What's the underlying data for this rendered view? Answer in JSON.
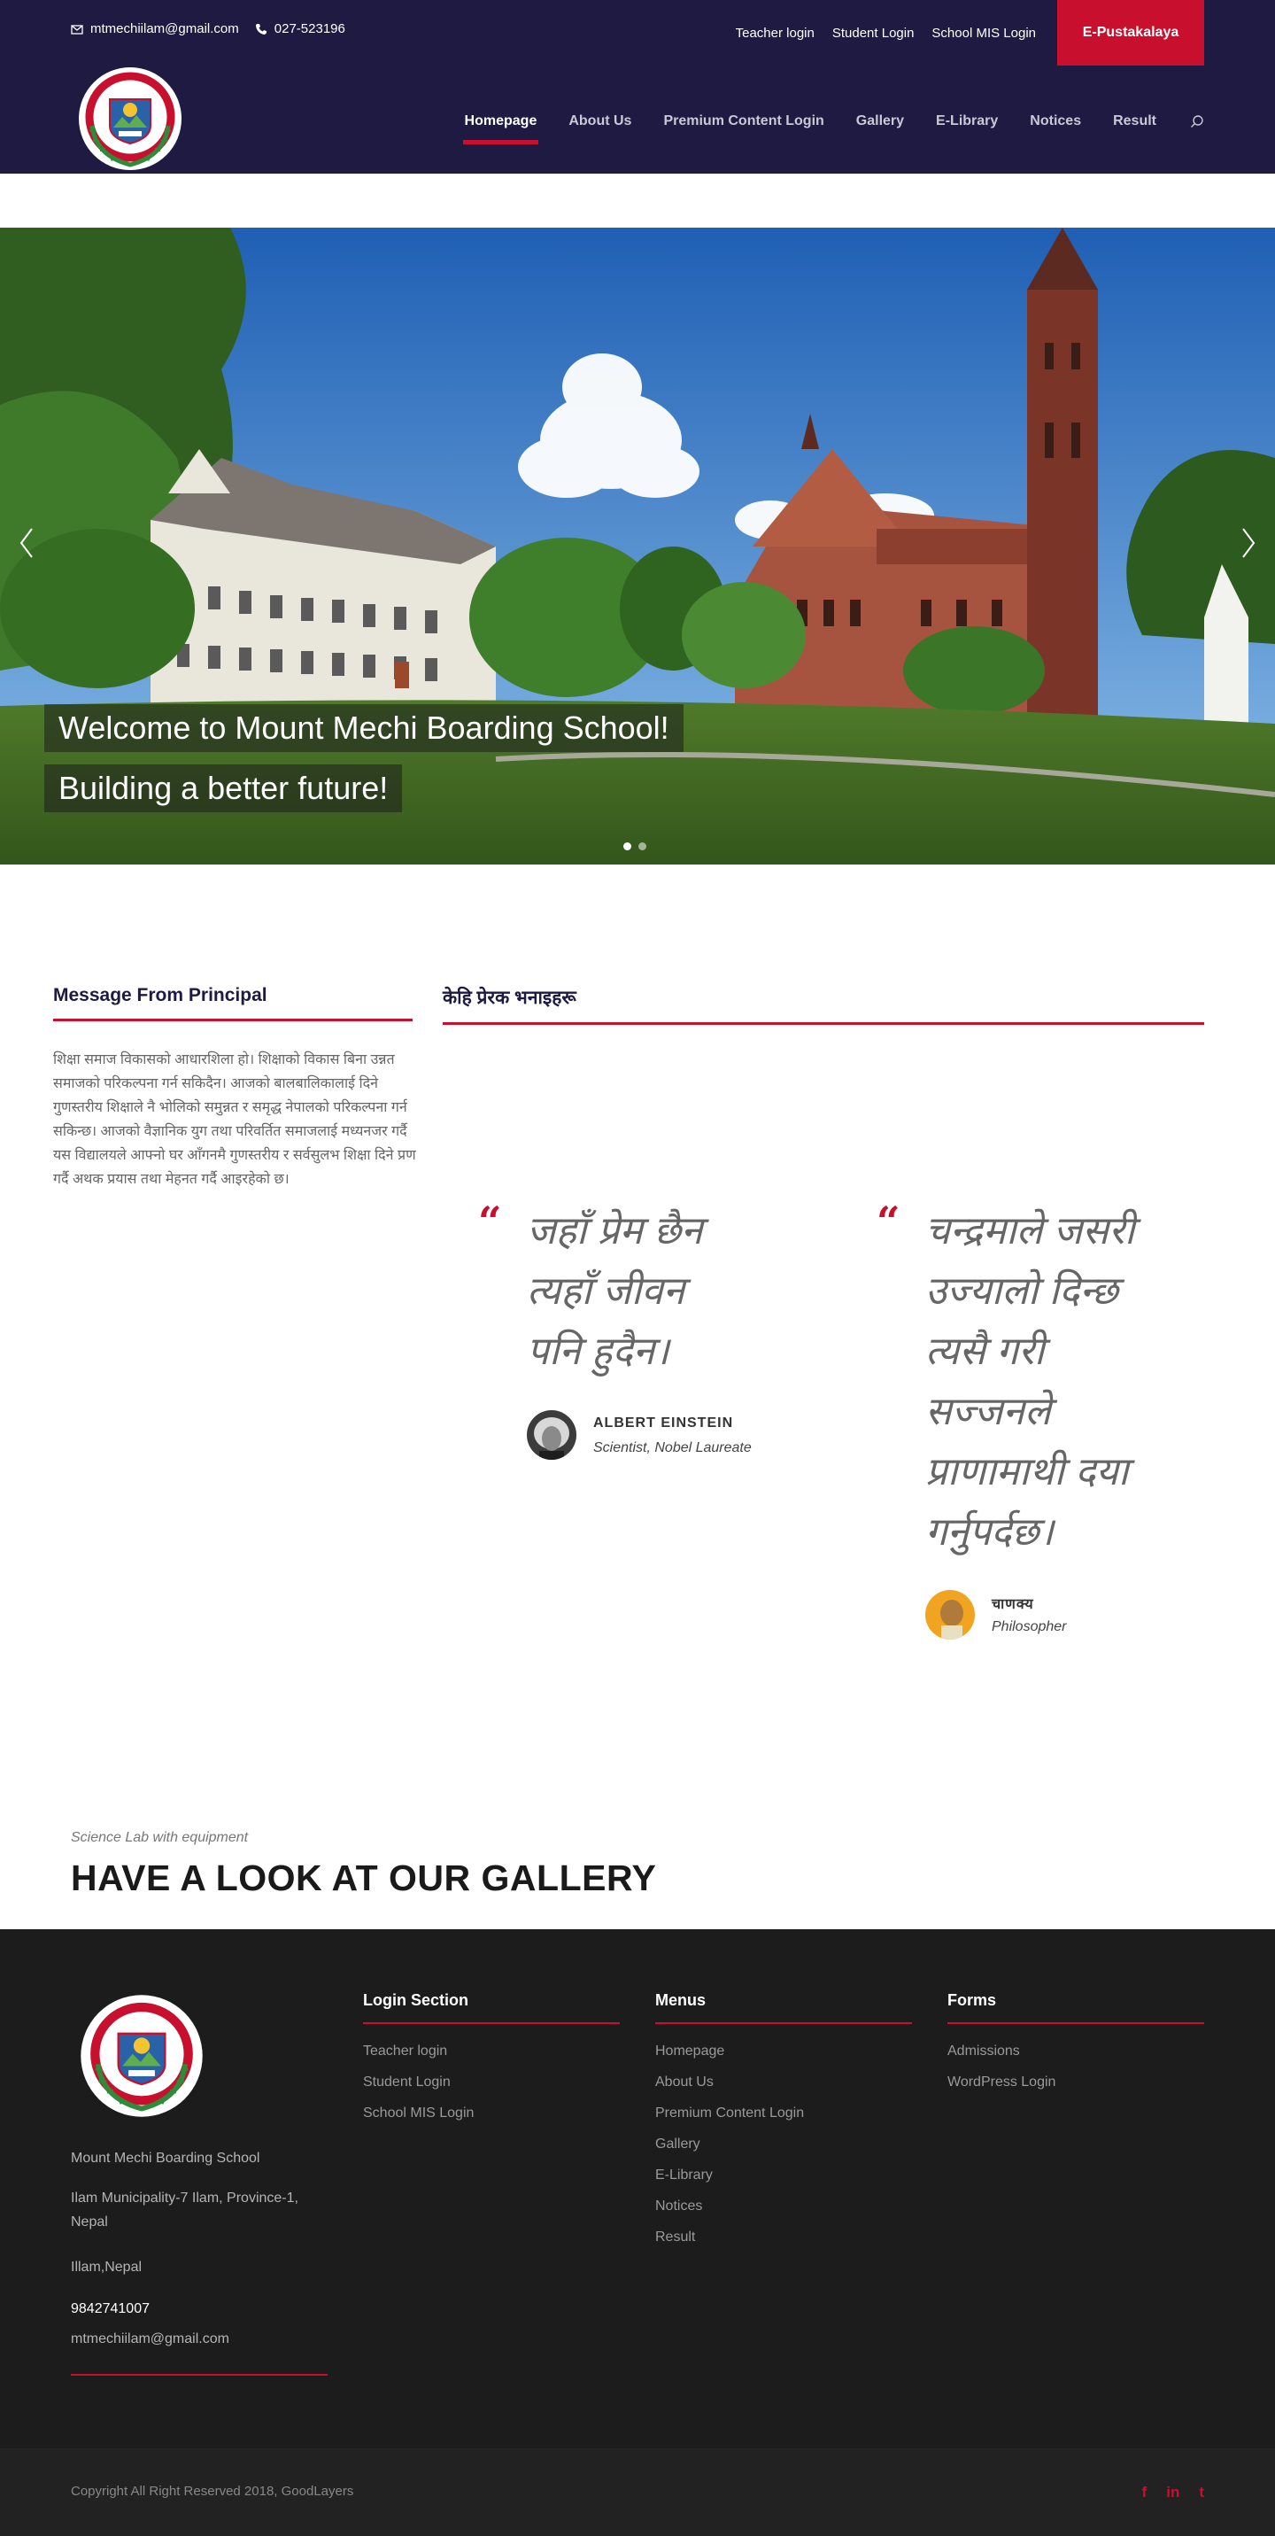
{
  "topbar": {
    "email": "mtmechiilam@gmail.com",
    "phone": "027-523196",
    "links": [
      "Teacher login",
      "Student Login",
      "School MIS Login"
    ],
    "cta": "E-Pustakalaya"
  },
  "nav": {
    "items": [
      "Homepage",
      "About Us",
      "Premium Content Login",
      "Gallery",
      "E-Library",
      "Notices",
      "Result"
    ],
    "active": "Homepage"
  },
  "hero": {
    "caption1": "Welcome to Mount Mechi Boarding School!",
    "caption2": "Building a better future!",
    "slide_count": 2,
    "active_slide": 1
  },
  "principal": {
    "heading": "Message From Principal",
    "text": "शिक्षा समाज विकासको आधारशिला हो। शिक्षाको विकास बिना उन्नत समाजको परिकल्पना गर्न सकिदैन। आजको बालबालिकालाई दिने गुणस्तरीय शिक्षाले नै भोलिको समुन्नत र समृद्ध नेपालको परिकल्पना गर्न सकिन्छ। आजको वैज्ञानिक युग तथा परिवर्तित समाजलाई मध्यनजर गर्दै यस विद्यालयले आफ्नो घर आँगनमै गुणस्तरीय र सर्वसुलभ शिक्षा दिने प्रण गर्दै अथक प्रयास तथा मेहनत गर्दै आइरहेको छ।"
  },
  "quotes": {
    "heading": "केहि प्रेरक भनाइहरू",
    "items": [
      {
        "lines": [
          "जहाँ प्रेम छैन",
          "त्यहाँ जीवन",
          "पनि हुदैन।"
        ],
        "author": "ALBERT EINSTEIN",
        "role": "Scientist, Nobel Laureate"
      },
      {
        "lines": [
          "चन्द्रमाले जसरी",
          "उज्यालो दिन्छ",
          "त्यसै गरी",
          "सज्जनले",
          "प्राणामाथी दया",
          "गर्नुपर्दछ।"
        ],
        "author": "चाणक्य",
        "role": "Philosopher"
      }
    ]
  },
  "gallery": {
    "subtitle": "Science Lab with equipment",
    "title": "HAVE A LOOK AT OUR GALLERY"
  },
  "footer": {
    "school_name": "Mount Mechi Boarding School",
    "address": "Ilam Municipality-7 Ilam, Province-1, Nepal",
    "city": "Illam,Nepal",
    "phone": "9842741007",
    "email": "mtmechiilam@gmail.com",
    "login": {
      "title": "Login Section",
      "links": [
        "Teacher login",
        "Student Login",
        "School MIS Login"
      ]
    },
    "menus": {
      "title": "Menus",
      "links": [
        "Homepage",
        "About Us",
        "Premium Content Login",
        "Gallery",
        "E-Library",
        "Notices",
        "Result"
      ]
    },
    "forms": {
      "title": "Forms",
      "links": [
        "Admissions",
        "WordPress Login"
      ]
    },
    "copyright": "Copyright All Right Reserved 2018, GoodLayers",
    "social": [
      "f",
      "in",
      "t"
    ]
  },
  "colors": {
    "navy": "#1e1a42",
    "red": "#c8102e",
    "footer": "#1c1c1c"
  },
  "icons": [
    "envelope-icon",
    "phone-icon",
    "search-icon",
    "chevron-left-icon",
    "chevron-right-icon",
    "quote-icon",
    "facebook-icon",
    "linkedin-icon",
    "twitter-icon"
  ]
}
